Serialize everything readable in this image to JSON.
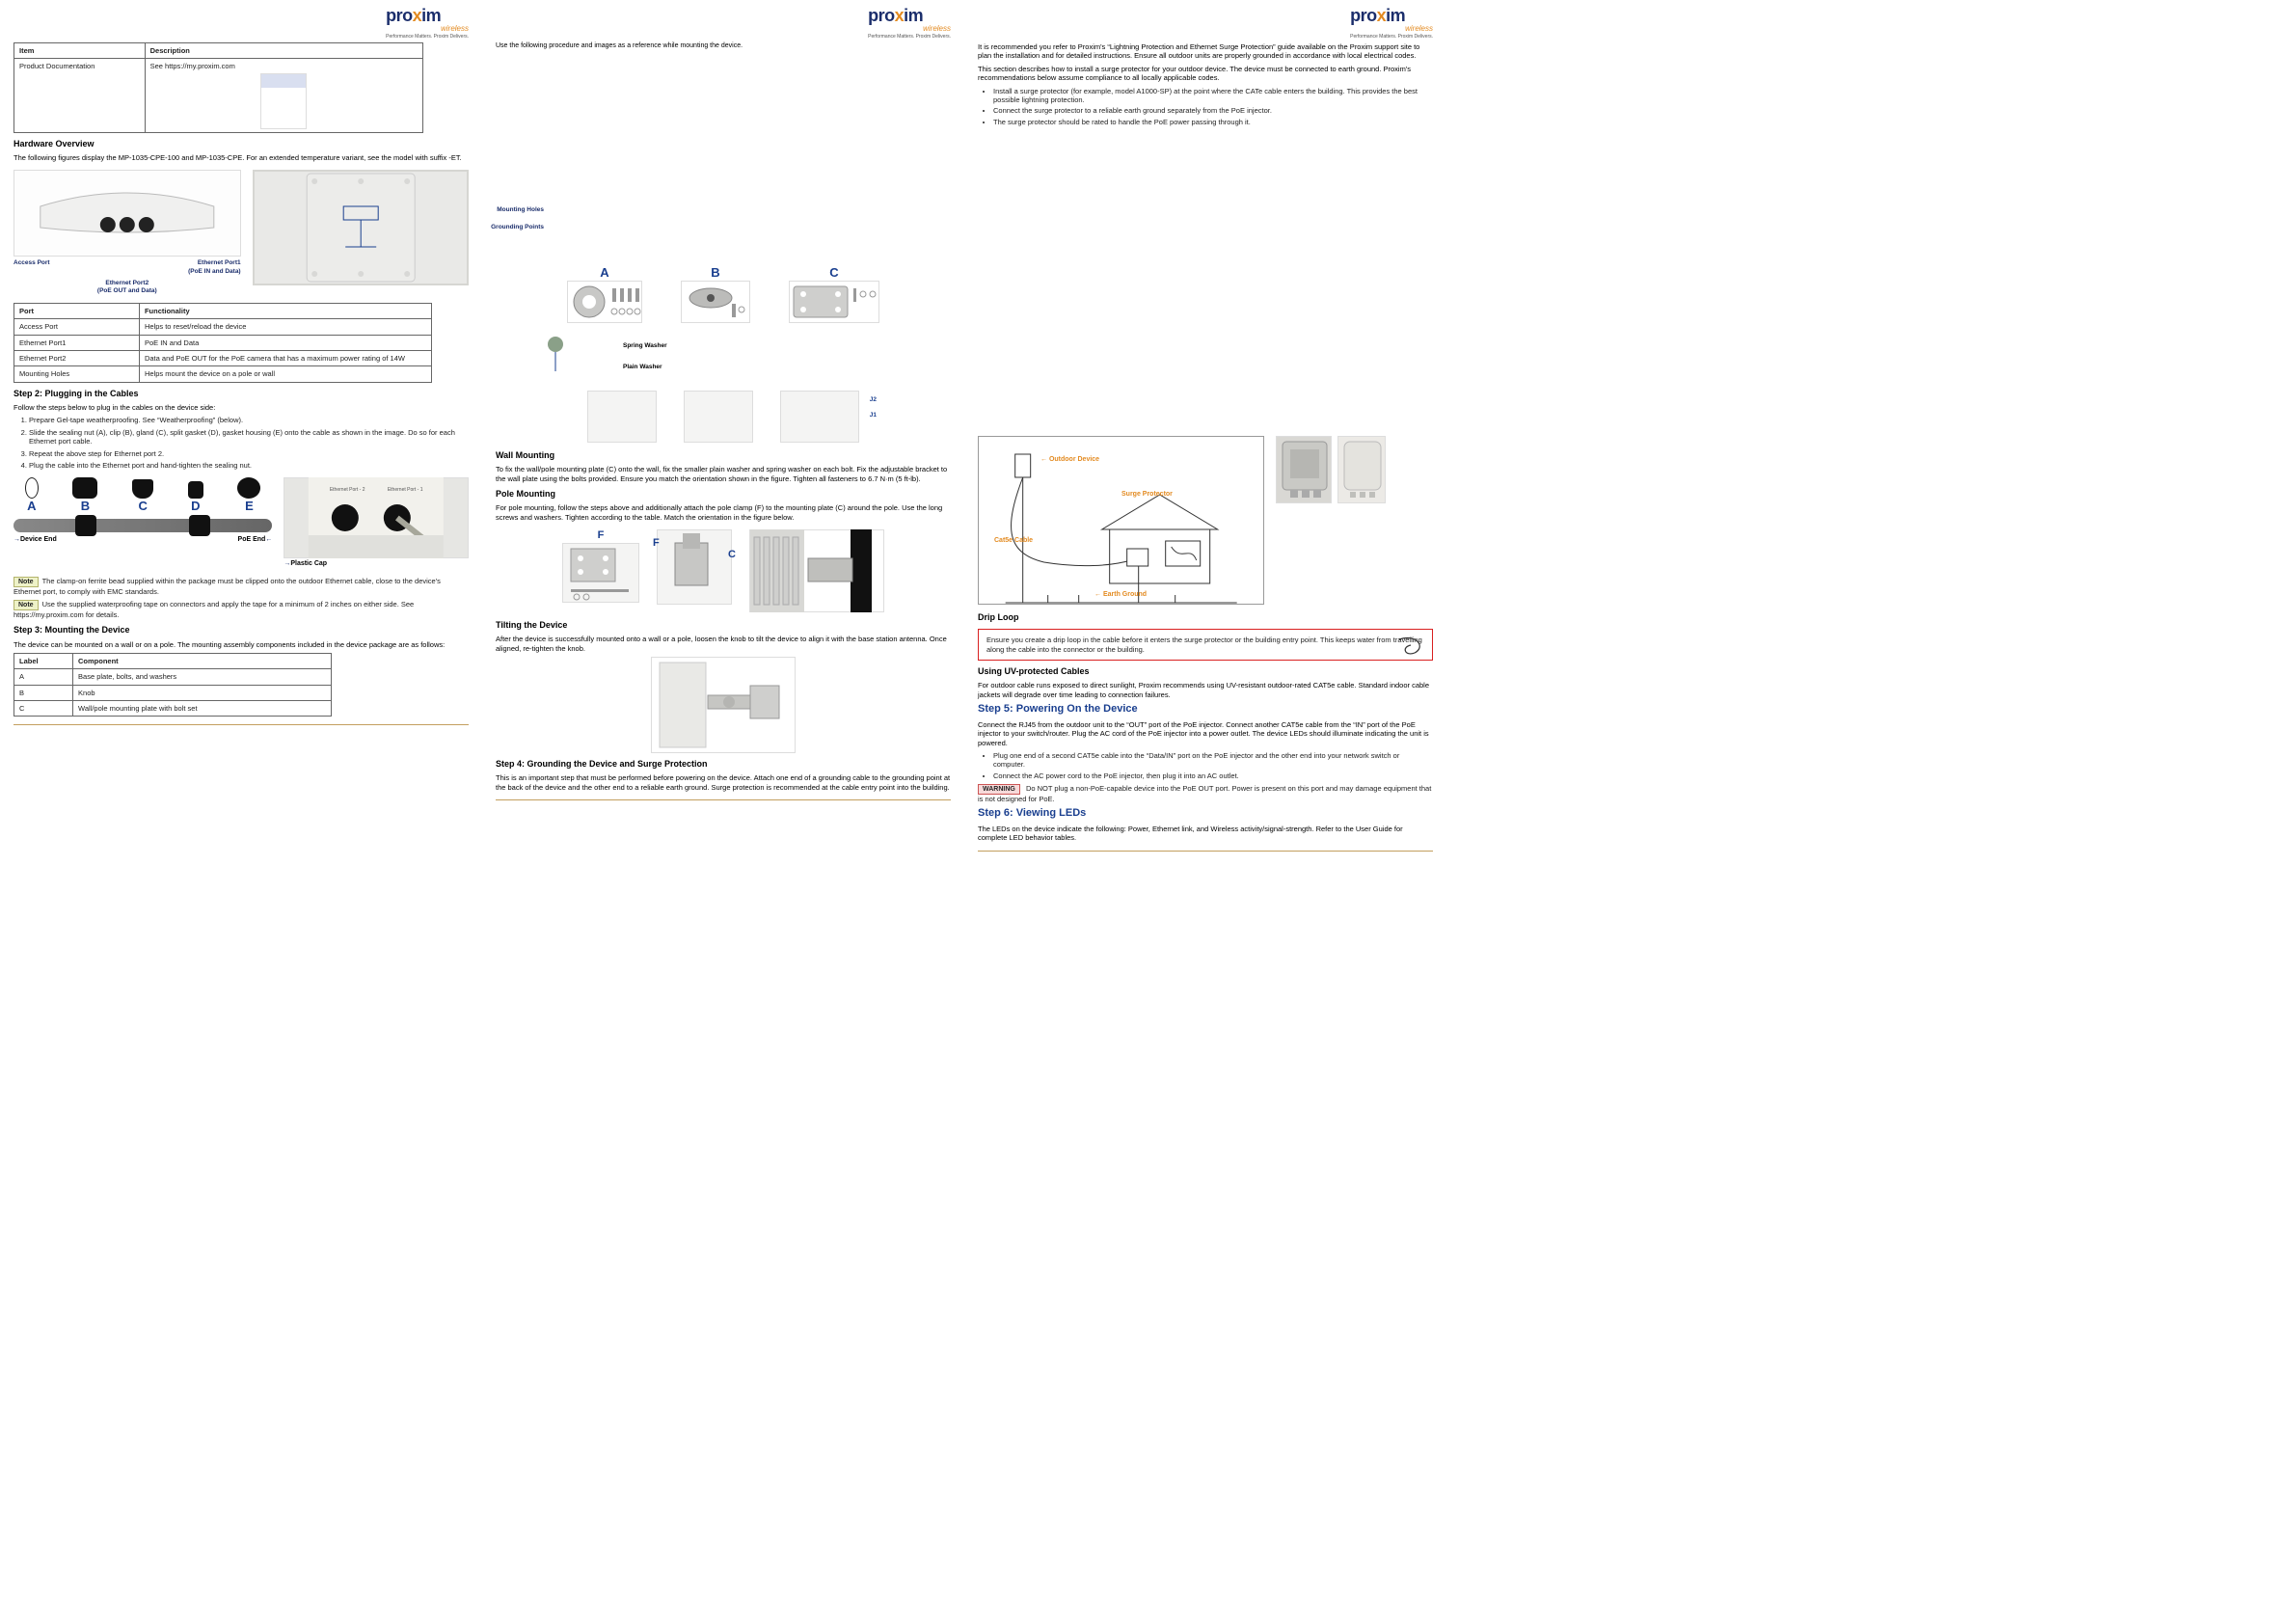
{
  "logo": {
    "brand_left": "pro",
    "brand_x": "x",
    "brand_right": "im",
    "sub": "wireless",
    "tagline": "Performance Matters. Proxim Delivers."
  },
  "col1": {
    "table1_head_item": "Item",
    "table1_head_desc": "Description",
    "table1_row1_item": "Product Documentation",
    "table1_row1_desc": "See https://my.proxim.com",
    "overview_title": "Hardware Overview",
    "overview_text": "The following figures display the MP-1035-CPE-100 and MP-1035-CPE. For an extended temperature variant, see the model with suffix -ET.",
    "labels": {
      "access_port": "Access Port",
      "eth1": "Ethernet Port1\n(PoE IN and Data)",
      "eth2": "Ethernet Port2\n(PoE OUT and Data)",
      "mount_holes": "Mounting Holes",
      "ground_pts": "Grounding Points"
    },
    "table2_head_port": "Port",
    "table2_head_func": "Functionality",
    "table2_r1_a": "Access Port",
    "table2_r1_b": "Helps to reset/reload the device",
    "table2_r2_a": "Ethernet Port1",
    "table2_r2_b": "PoE IN and Data",
    "table2_r3_a": "Ethernet Port2",
    "table2_r3_b": "Data and PoE OUT for the PoE camera that has a maximum power rating of 14W",
    "table2_r4_a": "Mounting Holes",
    "table2_r4_b": "Helps mount the device on a pole or wall",
    "step2_title": "Step 2: Plugging in the Cables",
    "step2_text": "Follow the steps below to plug in the cables on the device side:",
    "step2_li1": "Prepare Gel-tape weatherproofing. See “Weatherproofing” (below).",
    "step2_li2": "Slide the sealing nut (A), clip (B), gland (C), split gasket (D), gasket housing (E) onto the cable as shown in the image. Do so for each Ethernet port cable.",
    "step2_li3": "Repeat the above step for Ethernet port 2.",
    "step2_li4": "Plug the cable into the Ethernet port and hand-tighten the sealing nut.",
    "parts_A": "A",
    "parts_B": "B",
    "parts_C": "C",
    "parts_D": "D",
    "parts_E": "E",
    "device_end": "Device End",
    "poe_end": "PoE End",
    "plastic_cap": "Plastic Cap",
    "note_ferrite": "The clamp-on ferrite bead supplied within the package must be clipped onto the outdoor Ethernet cable, close to the device's Ethernet port, to comply with EMC standards.",
    "note_waterproof": "Use the supplied waterproofing tape on connectors and apply the tape for a minimum of 2 inches on either side. See https://my.proxim.com for details.",
    "step3_title": "Step 3: Mounting the Device",
    "step3_text1": "The device can be mounted on a wall or on a pole. The mounting assembly components included in the device package are as follows:",
    "mount_table": {
      "h1": "Label",
      "h2": "Component",
      "a": "A",
      "at": "Base plate, bolts, and washers",
      "b": "B",
      "bt": "Knob",
      "c": "C",
      "ct": "Wall/pole mounting plate with bolt set"
    },
    "note_label": "Note"
  },
  "col2": {
    "parts_label_a": "A",
    "parts_label_b": "B",
    "parts_label_c": "C",
    "spring_washer": "Spring Washer",
    "plain_washer": "Plain Washer",
    "wall_mount_title": "Wall Mounting",
    "wall_mount_text": "To fix the wall/pole mounting plate (C) onto the wall, fix the smaller plain washer and spring washer on each bolt. Fix the adjustable bracket to the wall plate using the bolts provided. Ensure you match the orientation shown in the figure. Tighten all fasteners to 6.7 N·m (5 ft-lb).",
    "pole_mount_title": "Pole Mounting",
    "pole_mount_text": "For pole mounting, follow the steps above and additionally attach the pole clamp (F) to the mounting plate (C) around the pole. Use the long screws and washers. Tighten according to the table. Match the orientation in the figure below.",
    "parts_F": "F",
    "parts_C2": "C",
    "j1": "J1",
    "j2": "J2",
    "tilt_title": "Tilting the Device",
    "tilt_text": "After the device is successfully mounted onto a wall or a pole, loosen the knob to tilt the device to align it with the base station antenna. Once aligned, re-tighten the knob.",
    "ground_title": "Step 4: Grounding the Device and Surge Protection",
    "ground_text": "This is an important step that must be performed before powering on the device. Attach one end of a grounding cable to the grounding point at the back of the device and the other end to a reliable earth ground. Surge protection is recommended at the cable entry point into the building."
  },
  "col3": {
    "intro1": "It is recommended you refer to Proxim's “Lightning Protection and Ethernet Surge Protection” guide available on the Proxim support site to plan the installation and for detailed instructions. Ensure all outdoor units are properly grounded in accordance with local electrical codes.",
    "intro2": "This section describes how to install a surge protector for your outdoor device. The device must be connected to earth ground. Proxim's recommendations below assume compliance to all locally applicable codes.",
    "bullet1": "Install a surge protector (for example, model A1000-SP) at the point where the CATe cable enters the building. This provides the best possible lightning protection.",
    "bullet2": "Connect the surge protector to a reliable earth ground separately from the PoE injector.",
    "bullet3": "The surge protector should be rated to handle the PoE power passing through it.",
    "diagram_labels": {
      "outdoor_device": "Outdoor Device",
      "surge_protector": "Surge Protector",
      "cat5e": "Cat5e Cable",
      "earth_ground": "Earth Ground"
    },
    "drip_title": "Drip Loop",
    "drip_text": "Ensure you create a drip loop in the cable before it enters the surge protector or the building entry point. This keeps water from travelling along the cable into the connector or the building.",
    "uv_title": "Using UV-protected Cables",
    "uv_text": "For outdoor cable runs exposed to direct sunlight, Proxim recommends using UV-resistant outdoor-rated CAT5e cable. Standard indoor cable jackets will degrade over time leading to connection failures.",
    "power_title": "Step 5: Powering On the Device",
    "power_text": "Connect the RJ45 from the outdoor unit to the “OUT” port of the PoE injector. Connect another CAT5e cable from the “IN” port of the PoE injector to your switch/router. Plug the AC cord of the PoE injector into a power outlet. The device LEDs should illuminate indicating the unit is powered.",
    "power_bullets": [
      "Plug one end of a second CAT5e cable into the “Data/IN” port on the PoE injector and the other end into your network switch or computer.",
      "Connect the AC power cord to the PoE injector, then plug it into an AC outlet."
    ],
    "warn_label": "WARNING",
    "warn_text": "Do NOT plug a non-PoE-capable device into the PoE OUT port. Power is present on this port and may damage equipment that is not designed for PoE.",
    "led_title": "Step 6: Viewing LEDs",
    "led_text": "The LEDs on the device indicate the following: Power, Ethernet link, and Wireless activity/signal-strength. Refer to the User Guide for complete LED behavior tables.",
    "note_label": "Note"
  }
}
